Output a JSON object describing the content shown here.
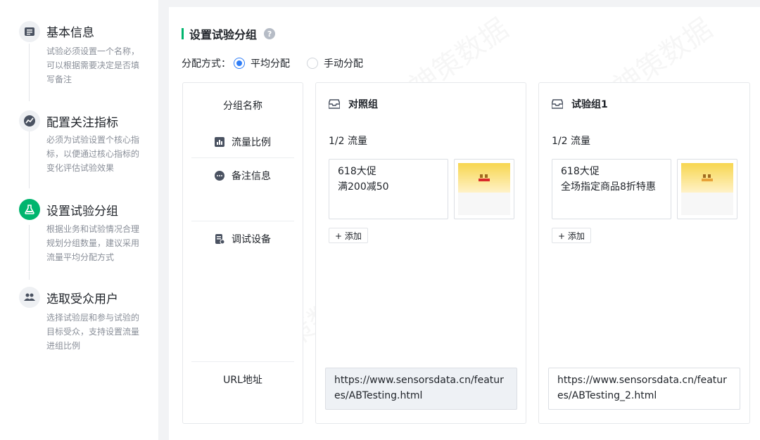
{
  "steps": [
    {
      "title": "基本信息",
      "desc": "试验必须设置一个名称，可以根据需要决定是否填写备注",
      "icon": "list-icon"
    },
    {
      "title": "配置关注指标",
      "desc": "必须为试验设置个核心指标，以便通过核心指标的变化评估试验效果",
      "icon": "trend-icon"
    },
    {
      "title": "设置试验分组",
      "desc": "根据业务和试验情况合理规划分组数量，建议采用流量平均分配方式",
      "icon": "flask-icon",
      "active": true
    },
    {
      "title": "选取受众用户",
      "desc": "选择试验层和参与试验的目标受众，支持设置流量进组比例",
      "icon": "users-icon"
    }
  ],
  "section": {
    "title": "设置试验分组",
    "help": "?"
  },
  "allocation": {
    "label": "分配方式：",
    "options": [
      {
        "label": "平均分配",
        "selected": true
      },
      {
        "label": "手动分配",
        "selected": false
      }
    ]
  },
  "names": {
    "header": "分组名称",
    "rows": [
      "流量比例",
      "备注信息",
      "调试设备",
      "URL地址"
    ]
  },
  "groups": [
    {
      "title": "对照组",
      "traffic": "1/2 流量",
      "note": [
        "618大促",
        "满200减50"
      ],
      "add": "+ 添加",
      "url": "https://www.sensorsdata.cn/features/ABTesting.html"
    },
    {
      "title": "试验组1",
      "traffic": "1/2 流量",
      "note": [
        "618大促",
        "全场指定商品8折特惠"
      ],
      "add": "+ 添加",
      "url": "https://www.sensorsdata.cn/features/ABTesting_2.html"
    }
  ],
  "colors": {
    "accent": "#00b56e",
    "radio": "#2f7df6"
  }
}
